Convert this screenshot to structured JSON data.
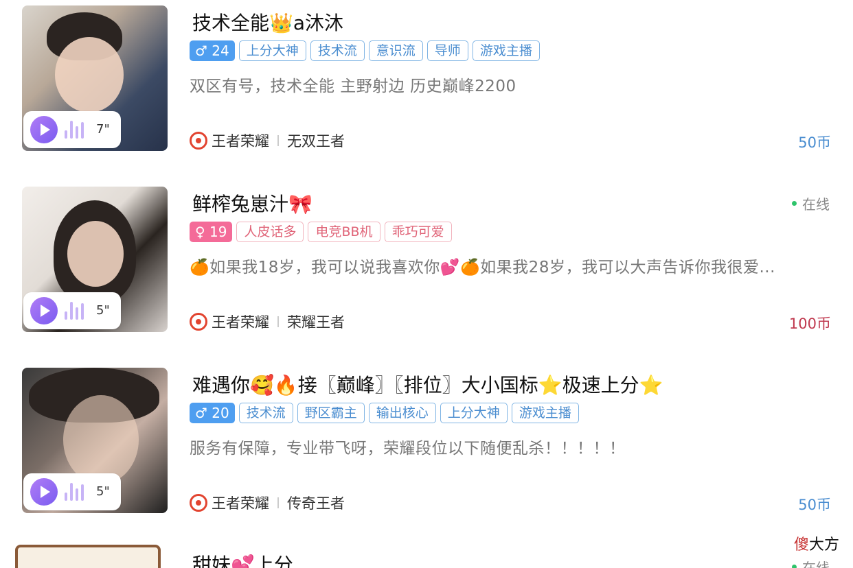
{
  "listings": [
    {
      "title": "技术全能👑a沐沐",
      "gender_symbol": "♂",
      "age": "24",
      "gender": "male",
      "tags": [
        "上分大神",
        "技术流",
        "意识流",
        "导师",
        "游戏主播"
      ],
      "description": "双区有号，技术全能 主野射边 历史巅峰2200",
      "game": "王者荣耀",
      "rank": "无双王者",
      "price": "50币",
      "voice_duration": "7\"",
      "status": ""
    },
    {
      "title": "鲜榨兔崽汁🎀",
      "gender_symbol": "♀",
      "age": "19",
      "gender": "female",
      "tags": [
        "人皮话多",
        "电竞BB机",
        "乖巧可爱"
      ],
      "description": "🍊如果我18岁，我可以说我喜欢你💕🍊如果我28岁，我可以大声告诉你我很爱...",
      "game": "王者荣耀",
      "rank": "荣耀王者",
      "price": "100币",
      "voice_duration": "5\"",
      "status": "在线"
    },
    {
      "title": "难遇你🥰🔥接〖巅峰〗〖排位〗大小国标⭐极速上分⭐",
      "gender_symbol": "♂",
      "age": "20",
      "gender": "male",
      "tags": [
        "技术流",
        "野区霸主",
        "输出核心",
        "上分大神",
        "游戏主播"
      ],
      "description": "服务有保障，专业带飞呀，荣耀段位以下随便乱杀！！！！！",
      "game": "王者荣耀",
      "rank": "传奇王者",
      "price": "50币",
      "voice_duration": "5\"",
      "status": ""
    },
    {
      "title": "甜妹💕上分",
      "status": "在线"
    }
  ],
  "watermark": {
    "part1": "傻",
    "part2": "大方"
  },
  "colors": {
    "male": "#4e9ef0",
    "female": "#f46b98",
    "online_dot": "#2ec46b",
    "price_blue": "#4a8dd0",
    "price_red": "#c0394f"
  }
}
